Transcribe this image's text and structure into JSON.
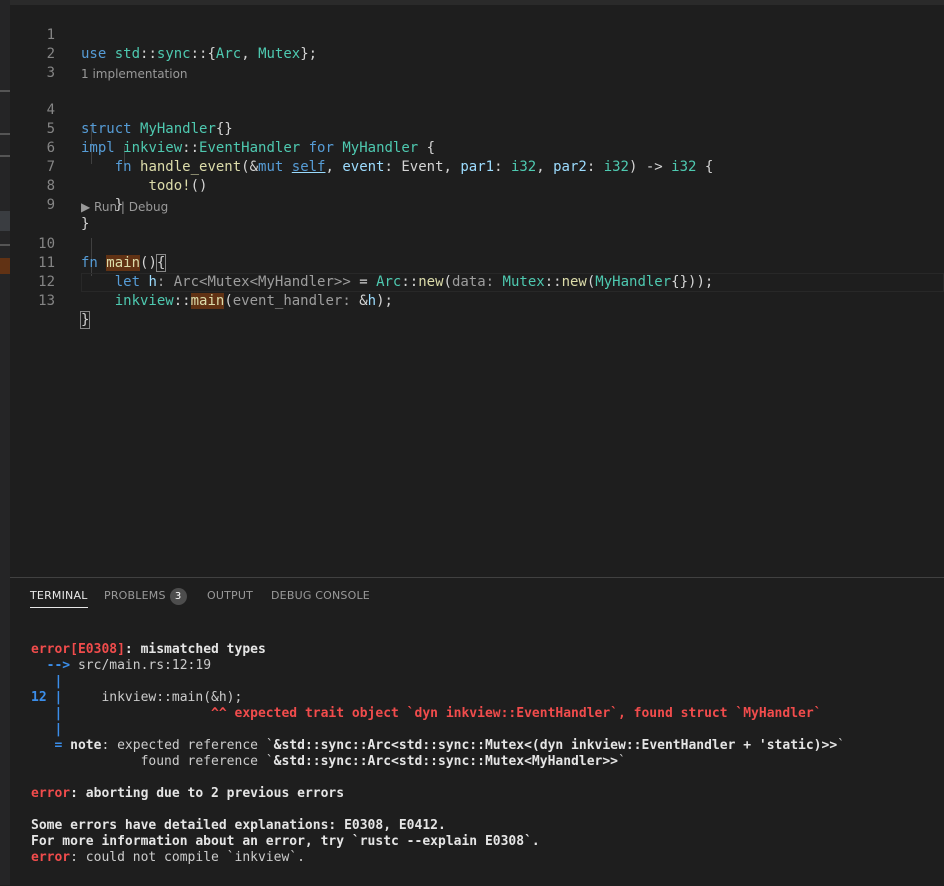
{
  "editor": {
    "lines": [
      {
        "num": "1"
      },
      {
        "num": "2"
      },
      {
        "num": "3"
      },
      {
        "num": "4"
      },
      {
        "num": "5"
      },
      {
        "num": "6"
      },
      {
        "num": "7"
      },
      {
        "num": "8"
      },
      {
        "num": "9"
      },
      {
        "num": "10"
      },
      {
        "num": "11"
      },
      {
        "num": "12"
      },
      {
        "num": "13"
      }
    ],
    "codelens_impl": "1 implementation",
    "codelens_run": "▶ Run",
    "codelens_sep": "|",
    "codelens_debug": "Debug",
    "tokens": {
      "use": "use",
      "std": "std",
      "sync": "sync",
      "arc": "Arc",
      "mutex": "Mutex",
      "struct": "struct",
      "myhandler": "MyHandler",
      "impl": "impl",
      "inkview": "inkview",
      "eventhandler": "EventHandler",
      "for": "for",
      "fn": "fn",
      "handle_event": "handle_event",
      "mut": "mut",
      "self": "self",
      "event": "event",
      "event_type": "Event",
      "par1": "par1",
      "par2": "par2",
      "i32": "i32",
      "todo": "todo!",
      "main": "main",
      "let": "let",
      "h": "h",
      "new": "new",
      "hint_h_type": "Arc<Mutex<MyHandler>>",
      "hint_data": "data:",
      "hint_event_handler": "event_handler:"
    }
  },
  "panel": {
    "tabs": [
      {
        "label": "TERMINAL"
      },
      {
        "label": "PROBLEMS",
        "badge": "3"
      },
      {
        "label": "OUTPUT"
      },
      {
        "label": "DEBUG CONSOLE"
      }
    ],
    "terminal": {
      "err_code": "error[E0308]",
      "err_msg": ": mismatched types",
      "arrow": "  -->",
      "location": " src/main.rs:12:19",
      "pipe": "   |",
      "line_no": "12 |",
      "src_code": "     inkview::main(&h);",
      "caret_pipe": "   |",
      "caret": "                   ^^ expected trait object `dyn inkview::EventHandler`, found struct `MyHandler`",
      "pipe2": "   |",
      "note_eq": "   =",
      "note_label": " note",
      "note_expected": ": expected reference `",
      "note_expected_type": "&std::sync::Arc<std::sync::Mutex<(dyn inkview::EventHandler + 'static)>>",
      "note_tick": "`",
      "found_prefix": "              found reference `",
      "found_type": "&std::sync::Arc<std::sync::Mutex<MyHandler>>",
      "found_tick": "`",
      "abort_label": "error",
      "abort_msg": ": aborting due to 2 previous errors",
      "explain1": "Some errors have detailed explanations: E0308, E0412.",
      "explain2": "For more information about an error, try `rustc --explain E0308`.",
      "final_label": "error",
      "final_msg": ": could not compile `inkview`."
    }
  },
  "colors": {
    "background": "#1e1e1e",
    "keyword": "#569cd6",
    "type": "#4ec9b0",
    "function": "#dcdcaa",
    "error_red": "#f14c4c",
    "terminal_blue": "#3b8eea",
    "highlight": "#613214"
  }
}
